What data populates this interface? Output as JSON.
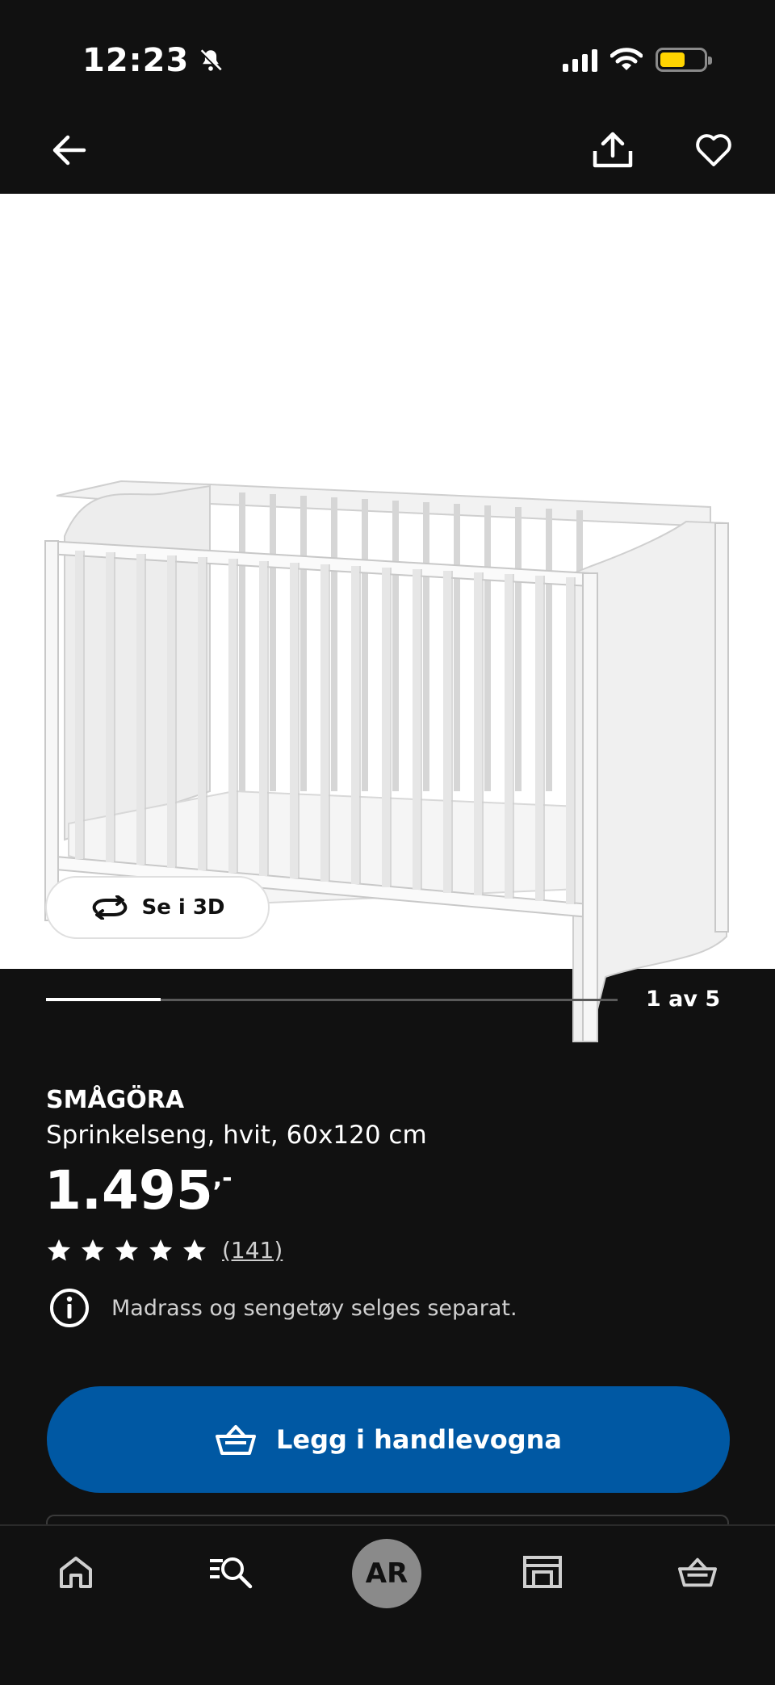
{
  "status_bar": {
    "time": "12:23"
  },
  "product": {
    "name": "SMÅGÖRA",
    "description": "Sprinkelseng, hvit, 60x120 cm",
    "price": "1.495",
    "price_suffix": ",-",
    "rating_stars": 5,
    "rating_count": "(141)",
    "info_note": "Madrass og sengetøy selges separat."
  },
  "gallery": {
    "view_3d_label": "Se i 3D",
    "position_label": "1 av 5",
    "progress_fraction": 0.2
  },
  "actions": {
    "add_to_cart_label": "Legg i handlevogna"
  },
  "bottom_nav": {
    "ar_label": "AR"
  },
  "colors": {
    "accent_blue": "#0058a3",
    "background": "#111111"
  }
}
